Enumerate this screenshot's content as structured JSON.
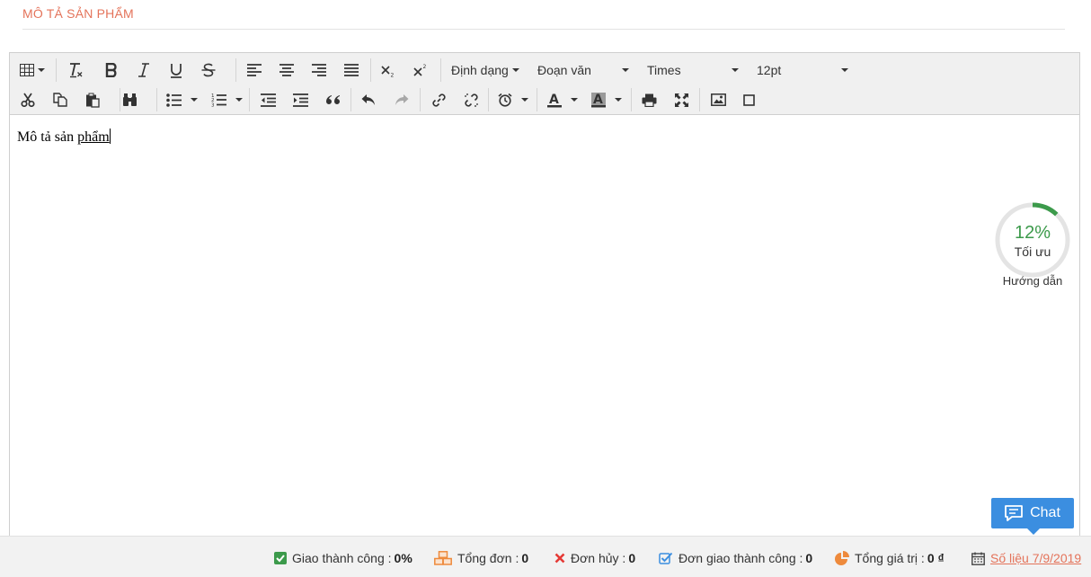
{
  "section": {
    "title": "MÔ TẢ SẢN PHẨM"
  },
  "toolbar": {
    "format_label": "Định dạng",
    "paragraph_label": "Đoạn văn",
    "font_label": "Times",
    "size_label": "12pt"
  },
  "content": {
    "text_before": "Mô tả sản ",
    "text_underlined": "phẩm"
  },
  "seo": {
    "percent_text": "12%",
    "percent_value": 12,
    "label": "Tối ưu",
    "guide": "Hướng dẫn",
    "color": "#3c9a4b"
  },
  "chat": {
    "label": "Chat",
    "color": "#3b8ee0"
  },
  "status": {
    "success_label": "Giao thành công :",
    "success_value": "0%",
    "total_label": "Tổng đơn :",
    "total_value": "0",
    "cancel_label": "Đơn hủy :",
    "cancel_value": "0",
    "delivered_label": "Đơn giao thành công :",
    "delivered_value": "0",
    "value_label": "Tổng giá trị :",
    "value_value": "0 ₫",
    "report_link": "Số liệu 7/9/2019"
  },
  "colors": {
    "accent": "#e4735a",
    "success": "#3c9a4b",
    "error": "#e53935",
    "info": "#3b8ee0",
    "orange": "#ee8a3c"
  }
}
